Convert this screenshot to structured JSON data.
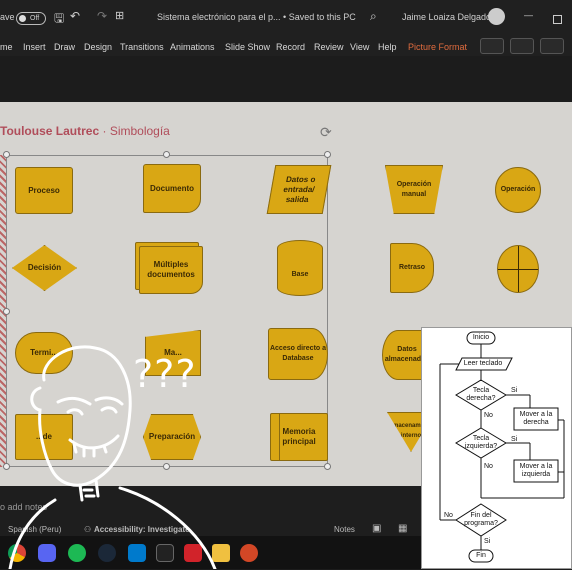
{
  "titlebar": {
    "autosave_label": "ave",
    "autosave_state": "Off",
    "doc_title": "Sistema electrónico para el p... • Saved to this PC",
    "user_name": "Jaime Loaiza Delgado"
  },
  "ribbon": {
    "tabs": [
      "me",
      "Insert",
      "Draw",
      "Design",
      "Transitions",
      "Animations",
      "Slide Show",
      "Record",
      "Review",
      "View",
      "Help",
      "Picture Format"
    ],
    "active_tab_color": "#e06b3e"
  },
  "slide": {
    "title": "Toulouse Lautrec",
    "separator": "·",
    "subtitle": "Simbología",
    "shapes": [
      {
        "label": "Proceso"
      },
      {
        "label": "Documento"
      },
      {
        "label": "Datos o entrada/ salida"
      },
      {
        "label": "Operación manual"
      },
      {
        "label": "Operación"
      },
      {
        "label": "Decisión"
      },
      {
        "label": "Múltiples documentos"
      },
      {
        "label": "Base"
      },
      {
        "label": "Retraso"
      },
      {
        "label": ""
      },
      {
        "label": "Termi..."
      },
      {
        "label": "Ma..."
      },
      {
        "label": "Acceso directo a Database"
      },
      {
        "label": "Datos almacenados"
      },
      {
        "label": ""
      },
      {
        "label": "...de"
      },
      {
        "label": "Preparación"
      },
      {
        "label": "Memoria principal"
      },
      {
        "label": "Almacenamiento interno"
      }
    ],
    "shape_color": "#d9a714"
  },
  "statusbar": {
    "notes_hint": "o add notes",
    "language": "Spanish (Peru)",
    "accessibility": "Accessibility: Investigate",
    "notes_button": "Notes"
  },
  "overlay": {
    "question_marks": "???"
  },
  "flowchart": {
    "inicio": "Inicio",
    "leer": "Leer teclado",
    "q1": "Tecla derecha?",
    "q1_yes": "Si",
    "q1_no": "No",
    "act1": "Mover a la derecha",
    "q2": "Tecla izquierda?",
    "q2_yes": "Si",
    "q2_no": "No",
    "act2": "Mover a la izquierda",
    "q3": "Fin del programa?",
    "q3_yes": "Si",
    "q3_no": "No",
    "fin": "Fin"
  },
  "taskbar": {
    "icons": [
      "chrome-icon",
      "discord-icon",
      "spotify-icon",
      "steam-icon",
      "vscode-icon",
      "capcut-icon",
      "acrobat-icon",
      "explorer-icon",
      "powerpoint-icon"
    ]
  }
}
